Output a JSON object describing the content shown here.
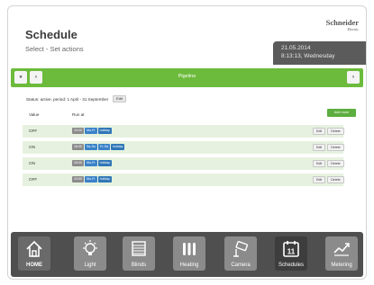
{
  "header": {
    "title": "Schedule",
    "subtitle": "Select - Set actions",
    "logo": "Schneider",
    "logo_sub": "Electric",
    "date": "21.05.2014",
    "time_day": "8:13:13, Wednesday"
  },
  "navbar": {
    "prev_group_label": "«",
    "prev_label": "‹",
    "title": "Pigeline",
    "next_label": "›"
  },
  "status": {
    "text": "Status: active, period: 1 April - 31 September",
    "edit_label": "Edit"
  },
  "table": {
    "columns": [
      "Value",
      "Run at"
    ],
    "add_label": "Add more",
    "rows": [
      {
        "value": "OFF",
        "chips": [
          {
            "label": "10:00",
            "kind": "time"
          },
          {
            "label": "Mo-Fr",
            "kind": "day"
          },
          {
            "label": "holiday",
            "kind": "hol"
          }
        ]
      },
      {
        "value": "ON",
        "chips": [
          {
            "label": "18:00",
            "kind": "time"
          },
          {
            "label": "Sa-Su",
            "kind": "day"
          },
          {
            "label": "Fr-Sa",
            "kind": "day"
          },
          {
            "label": "holiday",
            "kind": "hol"
          }
        ]
      },
      {
        "value": "ON",
        "chips": [
          {
            "label": "18:00",
            "kind": "time"
          },
          {
            "label": "Mo-Fr",
            "kind": "day"
          },
          {
            "label": "holiday",
            "kind": "hol"
          }
        ]
      },
      {
        "value": "OFF",
        "chips": [
          {
            "label": "23:00",
            "kind": "time"
          },
          {
            "label": "Mo-Fr",
            "kind": "day"
          },
          {
            "label": "holiday",
            "kind": "hol"
          }
        ]
      }
    ],
    "row_edit_label": "Edit",
    "row_delete_label": "Delete"
  },
  "dock": [
    {
      "label": "HOME",
      "icon": "home-icon"
    },
    {
      "label": "Light",
      "icon": "lightbulb-icon"
    },
    {
      "label": "Blinds",
      "icon": "blinds-icon"
    },
    {
      "label": "Heating",
      "icon": "radiator-icon"
    },
    {
      "label": "Camera",
      "icon": "camera-icon"
    },
    {
      "label": "Schedules",
      "icon": "calendar-icon",
      "badge": "11"
    },
    {
      "label": "Metering",
      "icon": "chart-icon"
    }
  ],
  "colors": {
    "accent_green": "#6cbb3c",
    "row_bg": "#e6f2df",
    "dock_bg": "#4f4f4f",
    "chip_blue": "#3a82c9"
  }
}
